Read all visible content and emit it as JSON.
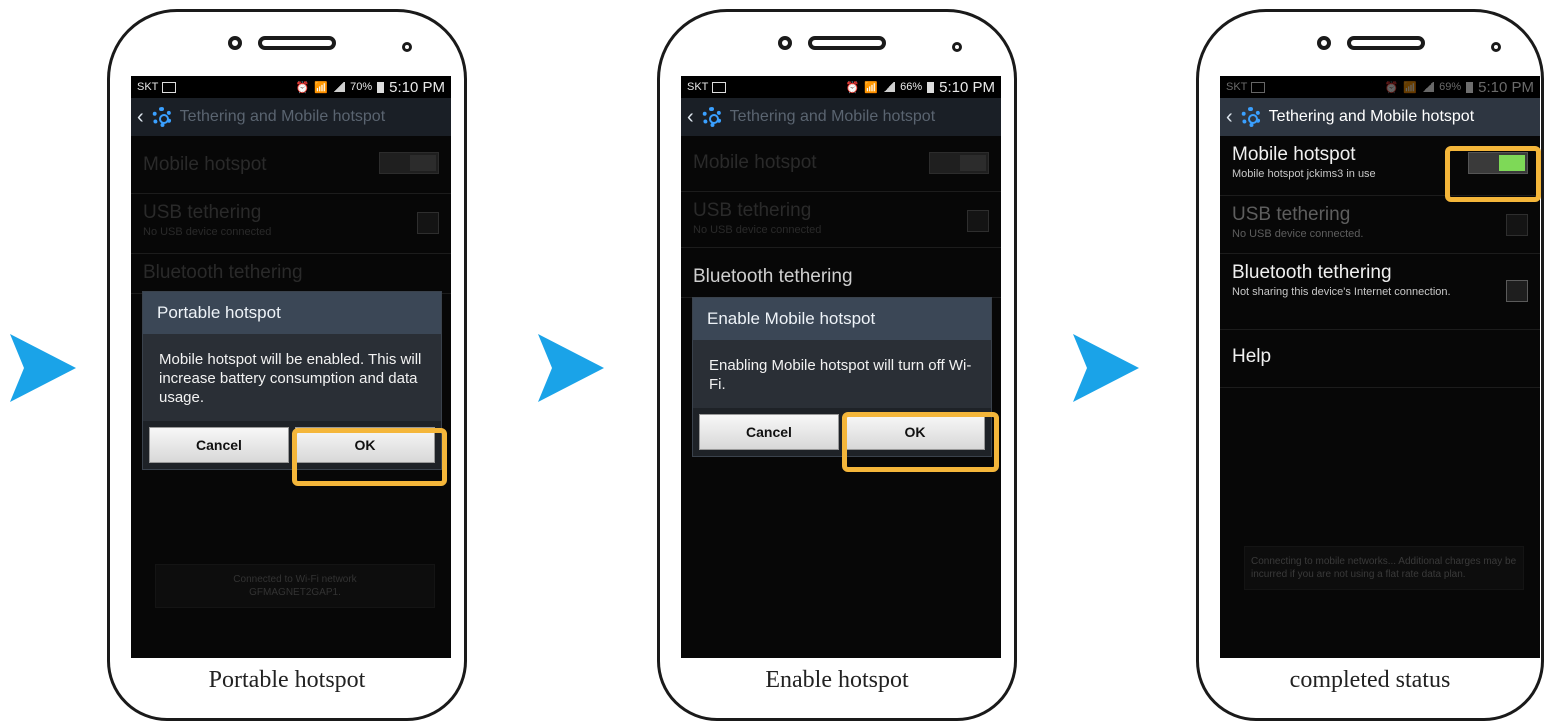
{
  "arrows": [
    "next-arrow",
    "next-arrow",
    "next-arrow"
  ],
  "phone1": {
    "caption": "Portable hotspot",
    "status": {
      "carrier": "SKT",
      "battery": "70%",
      "time": "5:10 PM"
    },
    "title": "Tethering and Mobile hotspot",
    "rows": {
      "mobile_hotspot": "Mobile hotspot",
      "usb_tethering": "USB tethering",
      "usb_sub": "No USB device connected",
      "bluetooth_tethering": "Bluetooth tethering"
    },
    "dialog": {
      "title": "Portable hotspot",
      "message": "Mobile hotspot will be enabled. This will increase battery consumption and data usage.",
      "cancel": "Cancel",
      "ok": "OK"
    },
    "note_line1": "Connected to Wi-Fi network",
    "note_line2": "GFMAGNET2GAP1."
  },
  "phone2": {
    "caption": "Enable hotspot",
    "status": {
      "carrier": "SKT",
      "battery": "66%",
      "time": "5:10 PM"
    },
    "title": "Tethering and Mobile hotspot",
    "rows": {
      "mobile_hotspot": "Mobile hotspot",
      "usb_tethering": "USB tethering",
      "usb_sub": "No USB device connected",
      "bluetooth_tethering": "Bluetooth tethering"
    },
    "dialog": {
      "title": "Enable Mobile hotspot",
      "message": "Enabling Mobile hotspot will turn off Wi-Fi.",
      "cancel": "Cancel",
      "ok": "OK"
    }
  },
  "phone3": {
    "caption": "completed status",
    "status": {
      "carrier": "SKT",
      "battery": "69%",
      "time": "5:10 PM"
    },
    "title": "Tethering and Mobile hotspot",
    "rows": {
      "mobile_hotspot": "Mobile hotspot",
      "mobile_hotspot_sub": "Mobile hotspot jckims3 in use",
      "usb_tethering": "USB tethering",
      "usb_sub": "No USB device connected.",
      "bluetooth_tethering": "Bluetooth tethering",
      "bluetooth_sub": "Not sharing this device's Internet connection.",
      "help": "Help"
    },
    "note": "Connecting to mobile networks... Additional charges may be incurred if you are not using a flat rate data plan."
  },
  "colors": {
    "accent": "#1aa3e8",
    "highlight": "#f4b63a",
    "toggle_on": "#7ed957",
    "actionbar": "#2e3641"
  }
}
